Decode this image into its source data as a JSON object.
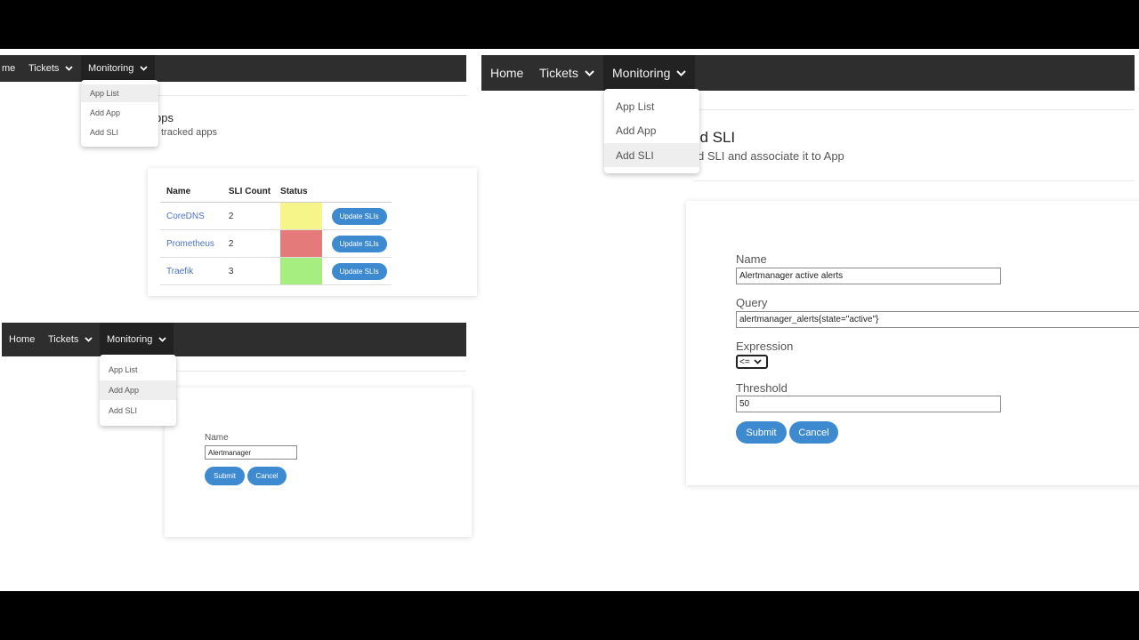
{
  "colors": {
    "navbar": "#2e2e2e",
    "accent_blue": "#3d8ad1",
    "status_yellow": "#f5f58a",
    "status_red": "#e47a7a",
    "status_green": "#a6ee80",
    "corner_teal": "#1f9b8c",
    "corner_orange": "#e0502a"
  },
  "panel_app_list": {
    "nav": {
      "home": "me",
      "tickets": "Tickets",
      "monitoring": "Monitoring"
    },
    "dropdown": [
      "App List",
      "Add App",
      "Add SLI"
    ],
    "heading_partial": "pps",
    "subtitle_partial": "tracked apps",
    "table": {
      "headers": [
        "Name",
        "SLI Count",
        "Status"
      ],
      "rows": [
        {
          "name": "CoreDNS",
          "count": "2",
          "status": "yellow",
          "button": "Update SLIs"
        },
        {
          "name": "Prometheus",
          "count": "2",
          "status": "red",
          "button": "Update SLIs"
        },
        {
          "name": "Traefik",
          "count": "3",
          "status": "green",
          "button": "Update SLIs"
        }
      ]
    }
  },
  "panel_add_app": {
    "nav": {
      "home": "Home",
      "tickets": "Tickets",
      "monitoring": "Monitoring"
    },
    "dropdown": [
      "App List",
      "Add App",
      "Add SLI"
    ],
    "form": {
      "name_label": "Name",
      "name_value": "Alertmanager",
      "submit": "Submit",
      "cancel": "Cancel"
    }
  },
  "panel_add_sli": {
    "nav": {
      "home": "Home",
      "tickets": "Tickets",
      "monitoring": "Monitoring"
    },
    "dropdown": [
      "App List",
      "Add App",
      "Add SLI"
    ],
    "heading_partial": "dd SLI",
    "subtitle_partial": "d SLI and associate it to App",
    "form": {
      "name_label": "Name",
      "name_value": "Alertmanager active alerts",
      "query_label": "Query",
      "query_value": "alertmanager_alerts{state=\"active\"}",
      "expression_label": "Expression",
      "expression_value": "<=",
      "threshold_label": "Threshold",
      "threshold_value": "50",
      "submit": "Submit",
      "cancel": "Cancel"
    }
  }
}
